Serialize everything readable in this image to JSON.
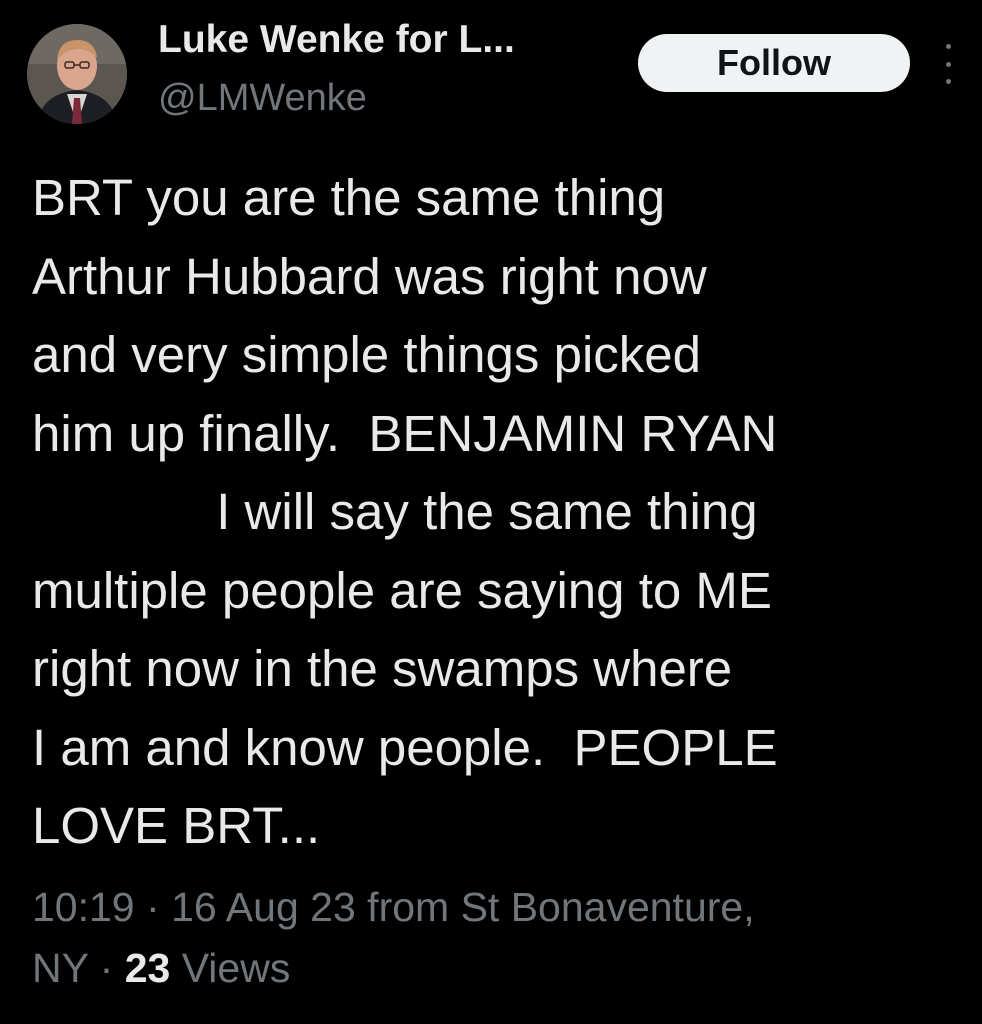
{
  "author": {
    "display_name": "Luke Wenke for L...",
    "handle": "@LMWenke",
    "avatar_icon": "profile-photo"
  },
  "follow_button": {
    "label": "Follow"
  },
  "more_menu": {
    "icon": "more-vertical-icon"
  },
  "tweet": {
    "lines": [
      "BRT you are the same thing",
      "Arthur Hubbard was right now",
      "and very simple things picked",
      "him up finally.  BENJAMIN RYAN",
      "             I will say the same thing",
      "multiple people are saying to ME",
      "right now in the swamps where",
      "I am and know people.  PEOPLE",
      "LOVE BRT..."
    ]
  },
  "meta": {
    "time": "10:19",
    "separator": "·",
    "date": "16 Aug 23",
    "source": "from St Bonaventure,",
    "location_cont": "NY",
    "views_count": "23",
    "views_label": "Views"
  },
  "colors": {
    "background": "#000000",
    "primary_text": "#e7e9ea",
    "secondary_text": "#71767b",
    "follow_bg": "#eff3f4"
  }
}
